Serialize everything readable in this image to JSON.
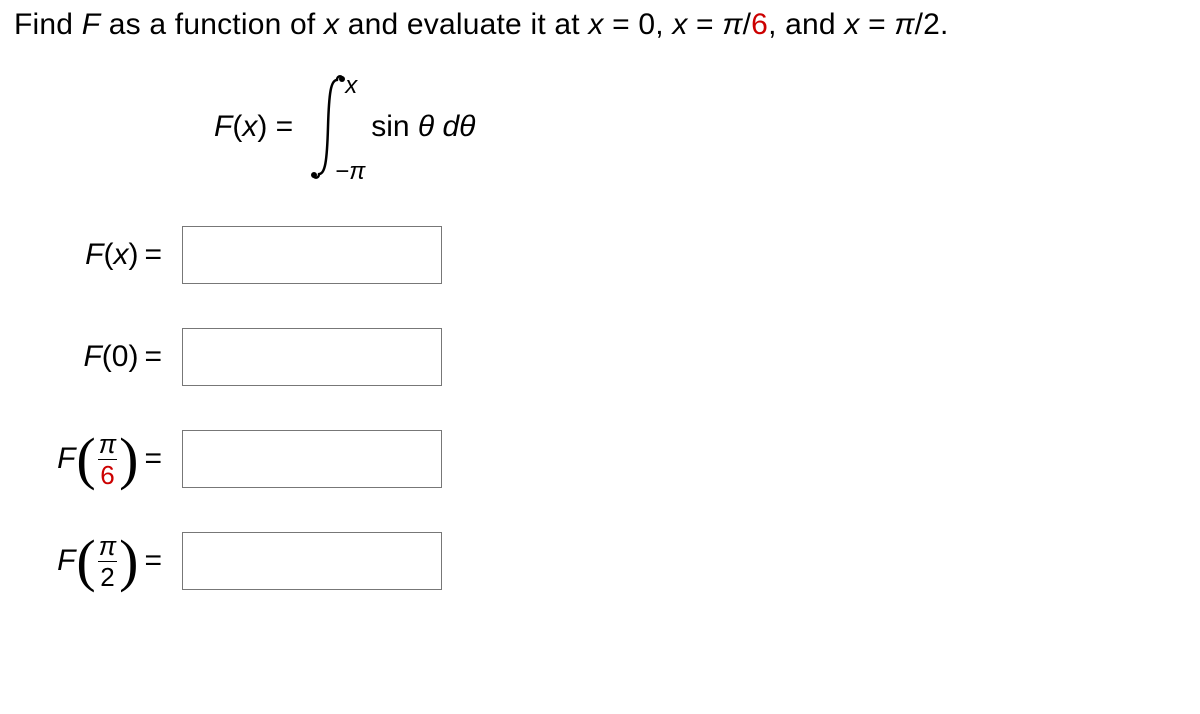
{
  "prompt": {
    "t1": "Find ",
    "F": "F",
    "t2": " as a function of ",
    "x": "x",
    "t3": " and evaluate it at ",
    "xeq1a": "x",
    "xeq1b": " = 0, ",
    "xeq2a": "x",
    "xeq2b": " = ",
    "pi1": "π",
    "slash1": "/",
    "six": "6",
    "t4": ", and ",
    "xeq3a": "x",
    "xeq3b": " = ",
    "pi2": "π",
    "slash2": "/2."
  },
  "equation": {
    "Fx": "F",
    "open": "(",
    "xvar": "x",
    "close": ")",
    "eq": " = ",
    "upper": "x",
    "lower1": "−",
    "lower2": "π",
    "sin": "sin ",
    "theta": "θ",
    "dth": " dθ"
  },
  "rows": {
    "r1": {
      "F": "F",
      "open": "(",
      "arg": "x",
      "close": ")",
      "eq": "="
    },
    "r2": {
      "F": "F",
      "open": "(",
      "arg": "0",
      "close": ")",
      "eq": "="
    },
    "r3": {
      "F": "F",
      "num": "π",
      "den": "6",
      "eq": "="
    },
    "r4": {
      "F": "F",
      "num": "π",
      "den": "2",
      "eq": "="
    }
  }
}
